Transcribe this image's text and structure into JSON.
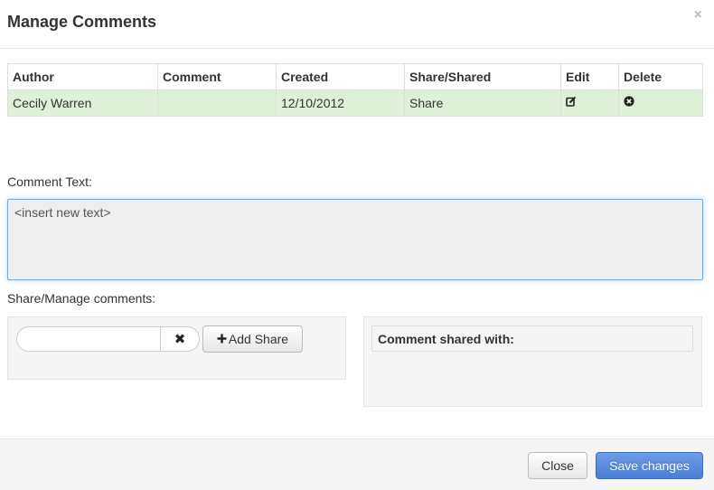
{
  "modal": {
    "title": "Manage Comments",
    "close_glyph": "×"
  },
  "table": {
    "headers": [
      "Author",
      "Comment",
      "Created",
      "Share/Shared",
      "Edit",
      "Delete"
    ],
    "rows": [
      {
        "author": "Cecily Warren",
        "comment": "",
        "created": "12/10/2012",
        "share": "Share",
        "edit_icon": "edit-icon",
        "delete_icon": "delete-icon"
      }
    ]
  },
  "comment_text": {
    "label": "Comment Text:",
    "value": "<insert new text>"
  },
  "share": {
    "label": "Share/Manage comments:",
    "input_value": "",
    "clear_glyph": "✖",
    "add_label": "Add Share",
    "add_icon": "plus-icon",
    "shared_with_label": "Comment shared with:"
  },
  "footer": {
    "close_label": "Close",
    "save_label": "Save changes"
  },
  "colors": {
    "success_row": "#dff0d8",
    "primary": "#4a7fd6",
    "focus_border": "#66afe9"
  }
}
